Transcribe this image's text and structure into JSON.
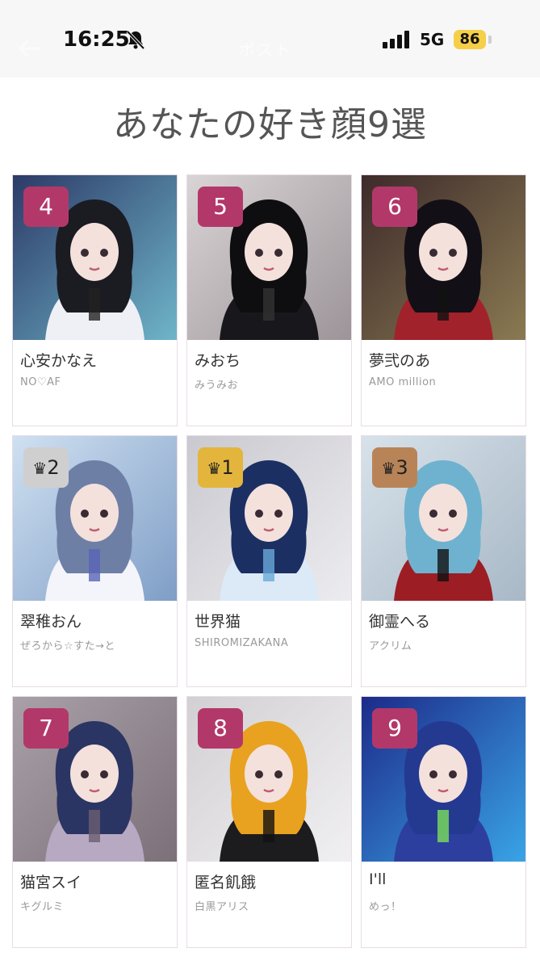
{
  "status_bar": {
    "time": "16:25",
    "network": "5G",
    "battery": "86"
  },
  "header": {
    "faint_title": "ポスト"
  },
  "page": {
    "title": "あなたの好き顔9選"
  },
  "colors": {
    "rank_pink": "#b3386a",
    "rank_gold": "#e3b53c",
    "rank_silver": "#cfcfcf",
    "rank_bronze": "#b88457",
    "card_border": "#e7dce6",
    "battery": "#f5cf47"
  },
  "cards": [
    {
      "rank_label": "4",
      "crown": "",
      "rank_style": "pink",
      "name": "心安かなえ",
      "group": "NO♡AF",
      "photo_theme": "night-city-white-outfit"
    },
    {
      "rank_label": "5",
      "crown": "",
      "rank_style": "pink",
      "name": "みおち",
      "group": "みうみお",
      "photo_theme": "black-gothic-dress"
    },
    {
      "rank_label": "6",
      "crown": "",
      "rank_style": "pink",
      "name": "夢弐のあ",
      "group": "AMO million",
      "photo_theme": "red-black-stained-glass"
    },
    {
      "rank_label": "2",
      "crown": "♛",
      "rank_style": "silver",
      "name": "翠稚おん",
      "group": "ぜろから☆すた→と",
      "photo_theme": "blue-white-sailor"
    },
    {
      "rank_label": "1",
      "crown": "♛",
      "rank_style": "gold",
      "name": "世界猫",
      "group": "SHIROMIZAKANA",
      "photo_theme": "light-blue-hoodie"
    },
    {
      "rank_label": "3",
      "crown": "♛",
      "rank_style": "bronze",
      "name": "御霊へる",
      "group": "アクリム",
      "photo_theme": "aqua-hair-red-dress"
    },
    {
      "rank_label": "7",
      "crown": "",
      "rank_style": "pink",
      "name": "猫宮スイ",
      "group": "キグルミ",
      "photo_theme": "lavender-ruffles"
    },
    {
      "rank_label": "8",
      "crown": "",
      "rank_style": "pink",
      "name": "匿名飢餓",
      "group": "白黒アリス",
      "photo_theme": "yellow-black-hair"
    },
    {
      "rank_label": "9",
      "crown": "",
      "rank_style": "pink",
      "name": "I'll",
      "group": "めっ！",
      "photo_theme": "neon-blue-cyber"
    }
  ]
}
